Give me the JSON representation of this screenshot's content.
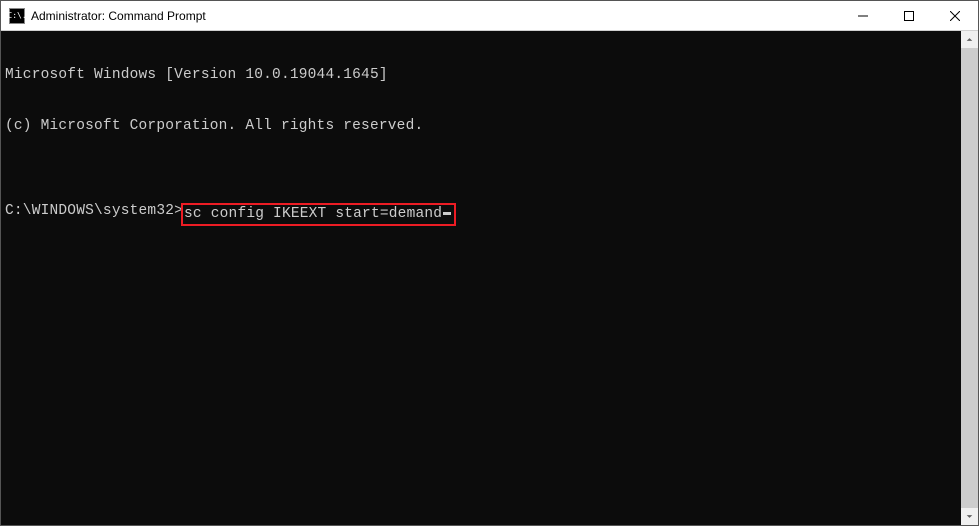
{
  "window": {
    "title": "Administrator: Command Prompt",
    "icon_text": "C:\\."
  },
  "terminal": {
    "line1": "Microsoft Windows [Version 10.0.19044.1645]",
    "line2": "(c) Microsoft Corporation. All rights reserved.",
    "blank": "",
    "prompt": "C:\\WINDOWS\\system32>",
    "command": "sc config IKEEXT start=demand"
  }
}
